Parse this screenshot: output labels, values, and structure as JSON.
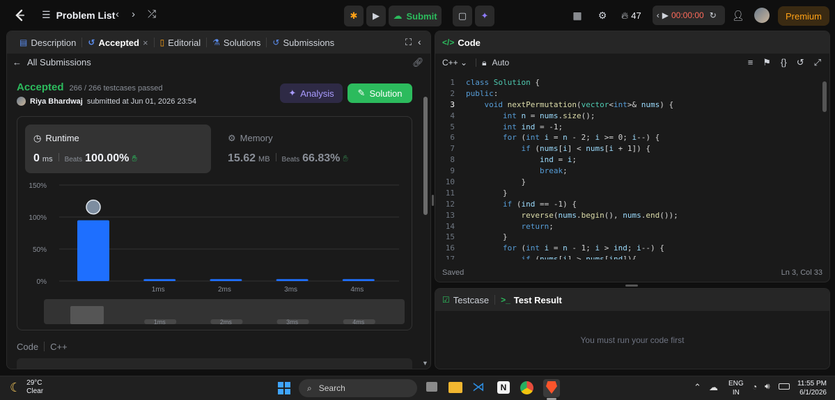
{
  "topbar": {
    "problem_list": "Problem List",
    "submit_label": "Submit",
    "streak_count": "47",
    "timer": "00:00:00",
    "premium_label": "Premium"
  },
  "left_tabs": [
    {
      "label": "Description"
    },
    {
      "label": "Accepted"
    },
    {
      "label": "Editorial"
    },
    {
      "label": "Solutions"
    },
    {
      "label": "Submissions"
    }
  ],
  "submission": {
    "back_label": "All Submissions",
    "status": "Accepted",
    "testcases": "266 / 266 testcases passed",
    "user": "Riya Bhardwaj",
    "submitted_at": "submitted at Jun 01, 2026 23:54",
    "analysis_label": "Analysis",
    "solution_label": "Solution"
  },
  "stats": {
    "runtime_label": "Runtime",
    "runtime_value": "0",
    "runtime_unit": "ms",
    "runtime_beats_label": "Beats",
    "runtime_beats": "100.00%",
    "memory_label": "Memory",
    "memory_value": "15.62",
    "memory_unit": "MB",
    "memory_beats_label": "Beats",
    "memory_beats": "66.83%"
  },
  "chart_data": {
    "type": "bar",
    "categories": [
      "",
      "1ms",
      "2ms",
      "3ms",
      "4ms"
    ],
    "values": [
      95,
      3,
      3,
      3,
      3
    ],
    "ylim": [
      0,
      150
    ],
    "yticks": [
      "150%",
      "100%",
      "50%",
      "0%"
    ],
    "mini_labels": [
      "1ms",
      "2ms",
      "3ms",
      "4ms"
    ]
  },
  "code_section": {
    "label": "Code",
    "lang": "C++"
  },
  "editor": {
    "title": "Code",
    "language": "C++",
    "mode": "Auto",
    "status": "Saved",
    "cursor": "Ln 3, Col 33",
    "lines": [
      "class Solution {",
      "public:",
      "    void nextPermutation(vector<int>& nums) {",
      "        int n = nums.size();",
      "        int ind = -1;",
      "        for (int i = n - 2; i >= 0; i--) {",
      "            if (nums[i] < nums[i + 1]) {",
      "                ind = i;",
      "                break;",
      "            }",
      "        }",
      "        if (ind == -1) {",
      "            reverse(nums.begin(), nums.end());",
      "            return;",
      "        }",
      "        for (int i = n - 1; i > ind; i--) {",
      "            if (nums[i] > nums[ind]){"
    ]
  },
  "testpanel": {
    "tab1": "Testcase",
    "tab2": "Test Result",
    "message": "You must run your code first"
  },
  "taskbar": {
    "temp": "29°C",
    "weather": "Clear",
    "search": "Search",
    "lang1": "ENG",
    "lang2": "IN",
    "time": "11:55 PM",
    "date": "6/1/2026"
  }
}
